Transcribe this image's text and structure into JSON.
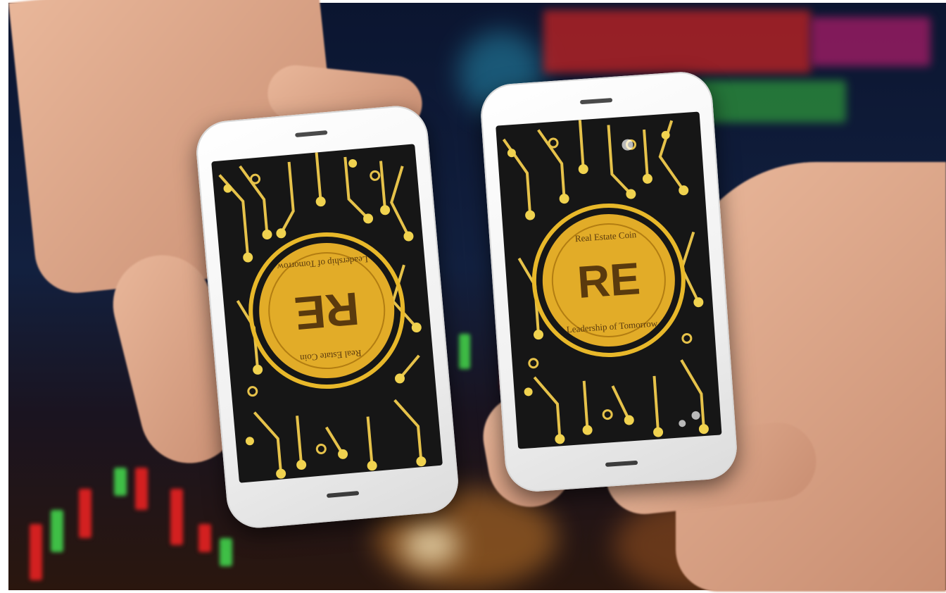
{
  "scene": "two-smartphones-showing-real-estate-coin",
  "phones": [
    {
      "id": "left",
      "coin": {
        "monogram": "RE",
        "top_text": "Real Estate Coin",
        "bottom_text": "Leadership of Tomorrow",
        "orientation": "upside-down"
      }
    },
    {
      "id": "right",
      "coin": {
        "monogram": "RE",
        "top_text": "Real Estate Coin",
        "bottom_text": "Leadership of Tomorrow",
        "orientation": "upright"
      }
    }
  ],
  "colors": {
    "coin_gold": "#e8b82a",
    "circuit_gold": "#e6c24a",
    "phone_body": "#f2f2f2",
    "screen_bg": "#141414"
  }
}
